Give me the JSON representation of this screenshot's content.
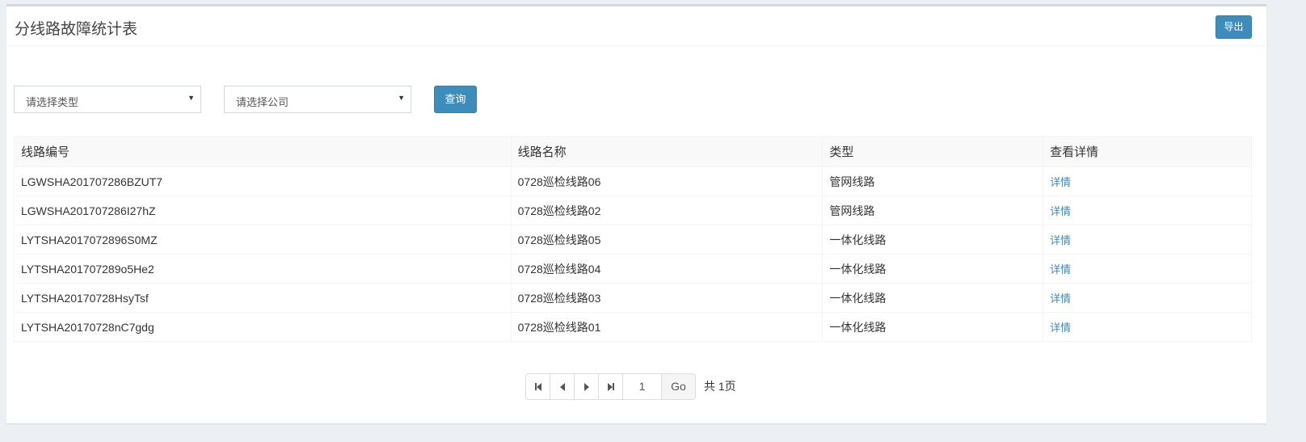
{
  "header": {
    "title": "分线路故障统计表",
    "export_label": "导出"
  },
  "filters": {
    "type_select": "请选择类型",
    "company_select": "请选择公司",
    "query_label": "查询"
  },
  "table": {
    "headers": [
      "线路编号",
      "线路名称",
      "类型",
      "查看详情"
    ],
    "rows": [
      {
        "code": "LGWSHA201707286BZUT7",
        "name": "0728巡检线路06",
        "type": "管网线路",
        "detail": "详情"
      },
      {
        "code": "LGWSHA201707286I27hZ",
        "name": "0728巡检线路02",
        "type": "管网线路",
        "detail": "详情"
      },
      {
        "code": "LYTSHA2017072896S0MZ",
        "name": "0728巡检线路05",
        "type": "一体化线路",
        "detail": "详情"
      },
      {
        "code": "LYTSHA201707289o5He2",
        "name": "0728巡检线路04",
        "type": "一体化线路",
        "detail": "详情"
      },
      {
        "code": "LYTSHA20170728HsyTsf",
        "name": "0728巡检线路03",
        "type": "一体化线路",
        "detail": "详情"
      },
      {
        "code": "LYTSHA20170728nC7gdg",
        "name": "0728巡检线路01",
        "type": "一体化线路",
        "detail": "详情"
      }
    ]
  },
  "pagination": {
    "current_page": "1",
    "go_label": "Go",
    "total_label": "共 1页"
  },
  "colors": {
    "primary": "#3c8dbc",
    "link": "#3c8dbc"
  }
}
